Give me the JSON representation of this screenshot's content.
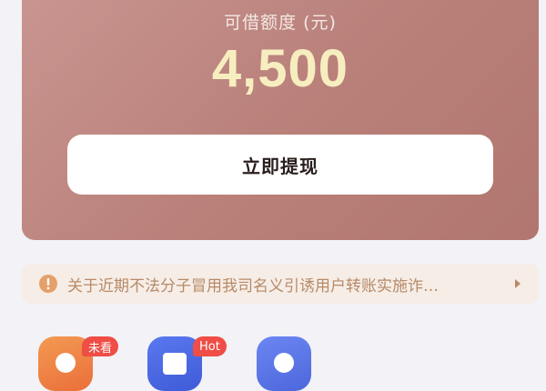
{
  "credit": {
    "label": "可借额度 (元)",
    "amount": "4,500"
  },
  "withdraw_button": {
    "label": "立即提现"
  },
  "notice": {
    "text": "关于近期不法分子冒用我司名义引诱用户转账实施诈…",
    "icon": "exclamation-circle-icon",
    "arrow_icon": "caret-right-icon"
  },
  "shortcuts": [
    {
      "badge": "未看",
      "color": "#ef7a43"
    },
    {
      "badge": "Hot",
      "color": "#4a66e0"
    },
    {
      "badge": "",
      "color": "#5570e3"
    }
  ],
  "colors": {
    "card": "#bb827c",
    "amount": "#f7eec0",
    "notice_bg": "#f6ede7",
    "notice_text": "#b78a66",
    "badge": "#ef4d45"
  }
}
